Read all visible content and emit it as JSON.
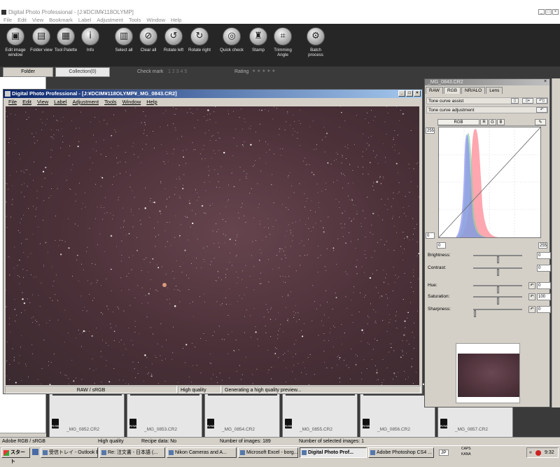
{
  "app": {
    "title": "Digital Photo Professional - [J:¥DCIM¥118OLYMP]",
    "menu": [
      "File",
      "Edit",
      "View",
      "Bookmark",
      "Label",
      "Adjustment",
      "Tools",
      "Window",
      "Help"
    ],
    "window_controls": [
      "_",
      "□",
      "×"
    ]
  },
  "toolbar": {
    "buttons": [
      {
        "label": "Edit image window",
        "icon": "edit-window-icon",
        "glyph": "▣"
      },
      {
        "label": "Folder view",
        "icon": "folder-icon",
        "glyph": "▤"
      },
      {
        "label": "Tool Palette",
        "icon": "tool-palette-icon",
        "glyph": "▦"
      },
      {
        "label": "Info",
        "icon": "info-icon",
        "glyph": "i"
      },
      {
        "label": "Select all",
        "icon": "select-all-icon",
        "glyph": "▥"
      },
      {
        "label": "Clear all",
        "icon": "clear-all-icon",
        "glyph": "⊘"
      },
      {
        "label": "Rotate left",
        "icon": "rotate-left-icon",
        "glyph": "↺"
      },
      {
        "label": "Rotate right",
        "icon": "rotate-right-icon",
        "glyph": "↻"
      },
      {
        "label": "Quick check",
        "icon": "quick-check-icon",
        "glyph": "◎"
      },
      {
        "label": "Stamp",
        "icon": "stamp-icon",
        "glyph": "♜"
      },
      {
        "label": "Trimming Angle",
        "icon": "trimming-icon",
        "glyph": "⌗"
      },
      {
        "label": "Batch process",
        "icon": "batch-icon",
        "glyph": "⚙"
      }
    ]
  },
  "tabs": {
    "folder": "Folder",
    "collection": "Collection(0)",
    "check_mark_label": "Check mark",
    "check_mark_values": "1 2 3 4 5",
    "rating_label": "Rating",
    "rating_stars": "★ ★ ★ ★ ★"
  },
  "image_window": {
    "title": "Digital Photo Professional - [J:¥DCIM¥118OLYMP¥_MG_0843.CR2]",
    "menu": [
      "File",
      "Edit",
      "View",
      "Label",
      "Adjustment",
      "Tools",
      "Window",
      "Help"
    ],
    "status": [
      "RAW / sRGB",
      "High quality",
      "Generating a high quality preview..."
    ]
  },
  "thumbnails": [
    {
      "name": "_MG_0852.CR2"
    },
    {
      "name": "_MG_0853.CR2"
    },
    {
      "name": "_MG_0854.CR2"
    },
    {
      "name": "_MG_0855.CR2"
    },
    {
      "name": "_MG_0856.CR2"
    },
    {
      "name": "_MG_0857.CR2"
    }
  ],
  "raw_badge": "RAW",
  "palette": {
    "title": "_MG_0843.CR2",
    "close": "×",
    "tabs": [
      "RAW",
      "RGB",
      "NR/ALO",
      "Lens"
    ],
    "tone_curve_assist": "Tone curve assist",
    "tone_curve_adjustment": "Tone curve adjustment",
    "channels": [
      "RGB",
      "R",
      "G",
      "B"
    ],
    "axis": {
      "top": "255",
      "left_bottom": "0",
      "bottom_left": "0",
      "bottom_right": "255"
    },
    "sliders": [
      {
        "label": "Brightness:",
        "value": "0",
        "level": 0.5,
        "undo": false
      },
      {
        "label": "Contrast:",
        "value": "0",
        "level": 0.5,
        "undo": false
      },
      {
        "label": "Hue:",
        "value": "0",
        "level": 0.5,
        "undo": true
      },
      {
        "label": "Saturation:",
        "value": "100",
        "level": 0.5,
        "undo": true
      },
      {
        "label": "Sharpness:",
        "value": "0",
        "level": 0.0,
        "undo": true
      }
    ]
  },
  "status": {
    "color_space": "Adobe RGB / sRGB",
    "quality": "High quality",
    "recipe": "Recipe data: No",
    "num_images": "Number of images: 189",
    "num_selected": "Number of selected images: 1"
  },
  "taskbar": {
    "start": "スタート",
    "tasks": [
      "受信トレイ - Outlook E...",
      "Re: 注文書 - 日本語 (...",
      "Nikon Cameras and A...",
      "Microsoft Excel - borg...",
      "Digital Photo Prof...",
      "Adobe Photoshop CS4 ..."
    ],
    "active_task": 4,
    "ime": "JP",
    "caps": "CAPS",
    "kana": "KANA",
    "clock": "9:32"
  },
  "colors": {
    "toolbar_bg": "#262626",
    "titlebar_active": "#0a246a",
    "sky": "#4b3038",
    "histogram_red": "#ff8a95",
    "histogram_green": "#7fd0a0",
    "histogram_blue": "#8a8ef0"
  }
}
